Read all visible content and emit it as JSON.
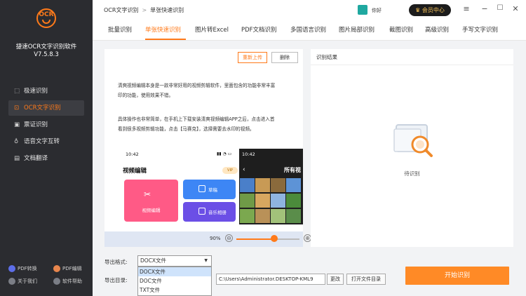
{
  "sidebar": {
    "logo_text": "OCR",
    "app_name": "捷速OCR文字识别软件",
    "version": "V7.5.8.3",
    "items": [
      {
        "label": "极速识别",
        "icon": "scan-icon"
      },
      {
        "label": "OCR文字识别",
        "icon": "ocr-icon"
      },
      {
        "label": "票证识别",
        "icon": "ticket-icon"
      },
      {
        "label": "语音文字互转",
        "icon": "microphone-icon"
      },
      {
        "label": "文档翻译",
        "icon": "document-icon"
      }
    ],
    "footer": [
      {
        "label": "PDF转换"
      },
      {
        "label": "PDF编辑"
      },
      {
        "label": "关于我们"
      },
      {
        "label": "软件帮助"
      }
    ]
  },
  "titlebar": {
    "breadcrumb_root": "OCR文字识别",
    "breadcrumb_sep": ">",
    "breadcrumb_current": "单张快速识别",
    "user_name": "你好",
    "vip_label": "会员中心"
  },
  "tabs": [
    "批量识别",
    "单张快速识别",
    "图片转Excel",
    "PDF文档识别",
    "多国语言识别",
    "图片局部识别",
    "截图识别",
    "高级识别",
    "手写文字识别"
  ],
  "active_tab": 1,
  "preview": {
    "reupload_label": "重新上传",
    "delete_label": "删除",
    "text_lines": [
      "清爽视频编辑本身是一款非常好用的视频剪辑软件，里面包含的功能非常丰富",
      "印的功能，使用效果不错。",
      "具体操作也非常简单，在手机上下载安装清爽视频编辑APP之后，点击进入首",
      "看到很多视频剪辑功能，点击【马赛克】，选择需要去水印的视频。"
    ],
    "phone_time_left": "10:42",
    "phone_time_right": "10:42",
    "video_edit_title": "视频编辑",
    "vip_tag": "VIP",
    "card_video_edit": "视频编辑",
    "card_draft": "草稿",
    "card_music_album": "音乐相册",
    "album_title": "所有视",
    "zoom_label": "90%",
    "zoom_value": 0.6,
    "zoom_minus": "⊖",
    "zoom_plus": "⊕"
  },
  "result": {
    "title": "识别结果",
    "status": "待识别",
    "icon": "image-search-icon"
  },
  "export": {
    "format_label": "导出格式:",
    "format_value": "DOCX文件",
    "format_options": [
      "DOCX文件",
      "DOC文件",
      "TXT文件"
    ],
    "dir_label": "导出目录:",
    "dir_value": "C:\\Users\\Administrator.DESKTOP-KML9",
    "change_label": "更改",
    "open_dir_label": "打开文件目录",
    "start_label": "开始识别"
  },
  "colors": {
    "accent": "#ff7a1a",
    "sidebar_bg": "#2b2c30",
    "start_button": "#ff8a26"
  }
}
